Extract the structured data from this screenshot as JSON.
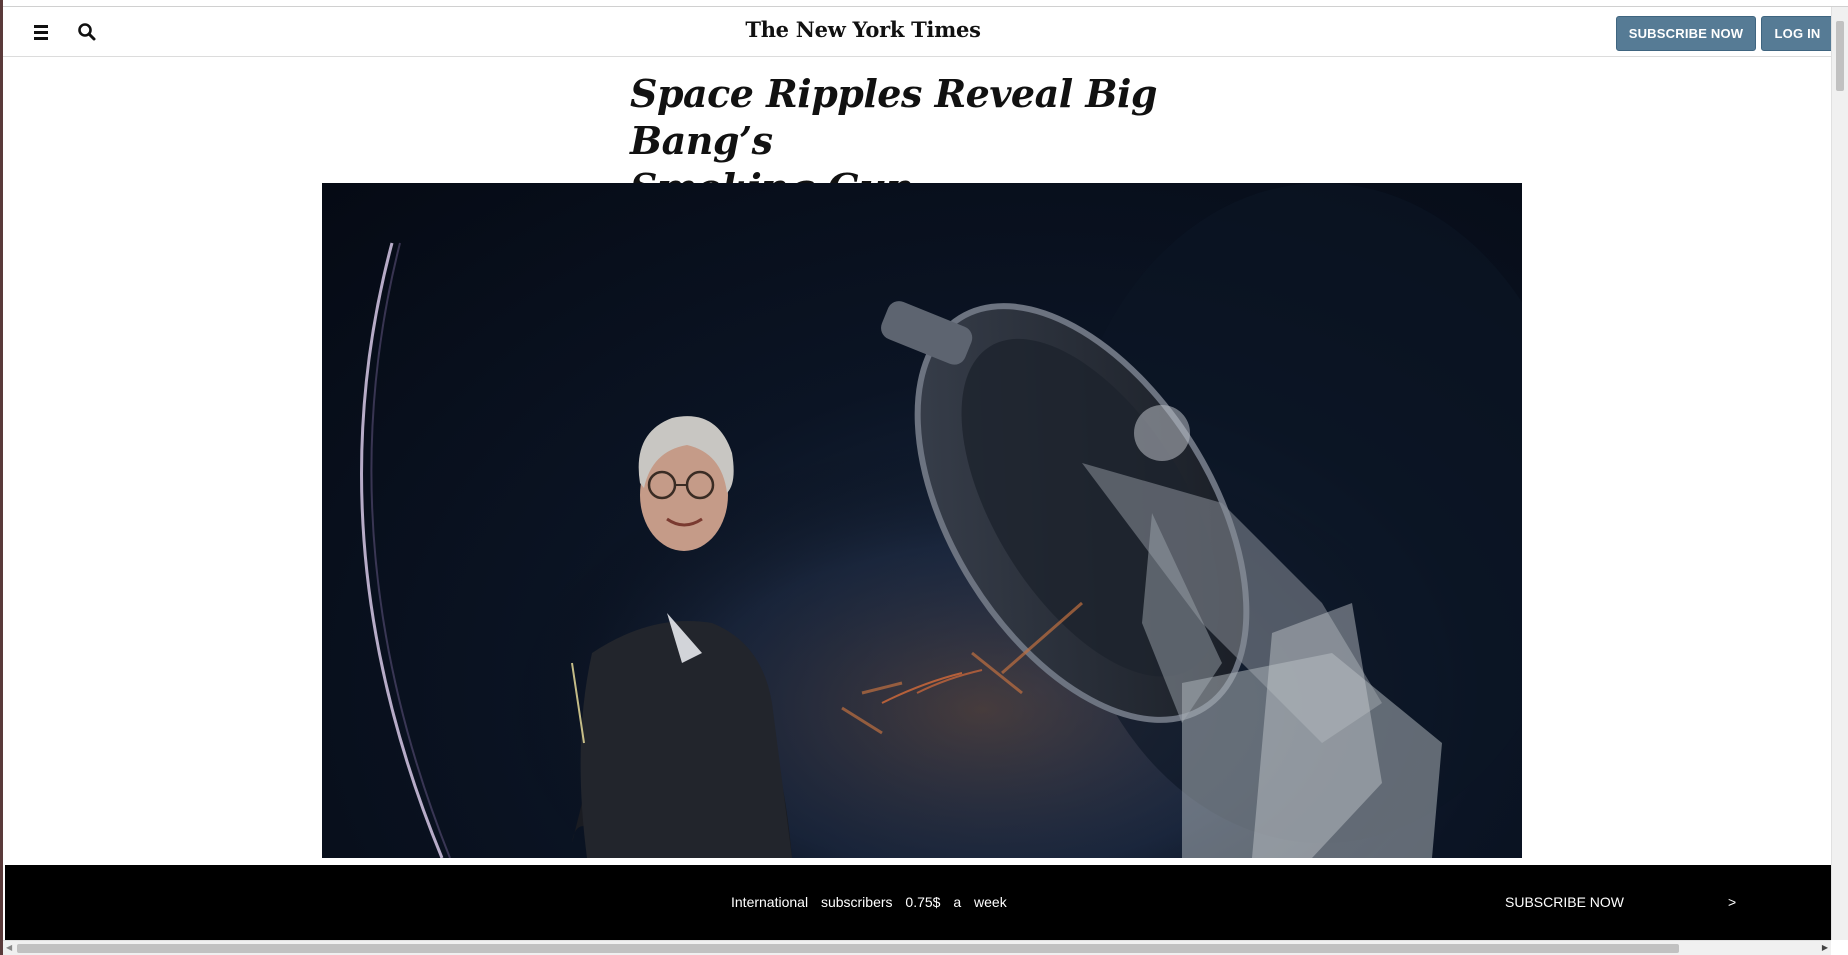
{
  "header": {
    "logo": "The New York Times",
    "subscribe_label": "SUBSCRIBE NOW",
    "login_label": "LOG IN"
  },
  "icons": {
    "menu": "hamburger-menu-icon",
    "search": "search-icon"
  },
  "article": {
    "headline_line1": "Space Ripples Reveal Big Bang’s",
    "headline_line2": "Smoking Gun"
  },
  "promo_bar": {
    "text": "International subscribers 0.75$ a week",
    "subscribe_label": "SUBSCRIBE NOW",
    "arrow": ">"
  },
  "colors": {
    "button": "#567b95",
    "promo_background": "#000000",
    "photo_background": "#0b1424"
  }
}
